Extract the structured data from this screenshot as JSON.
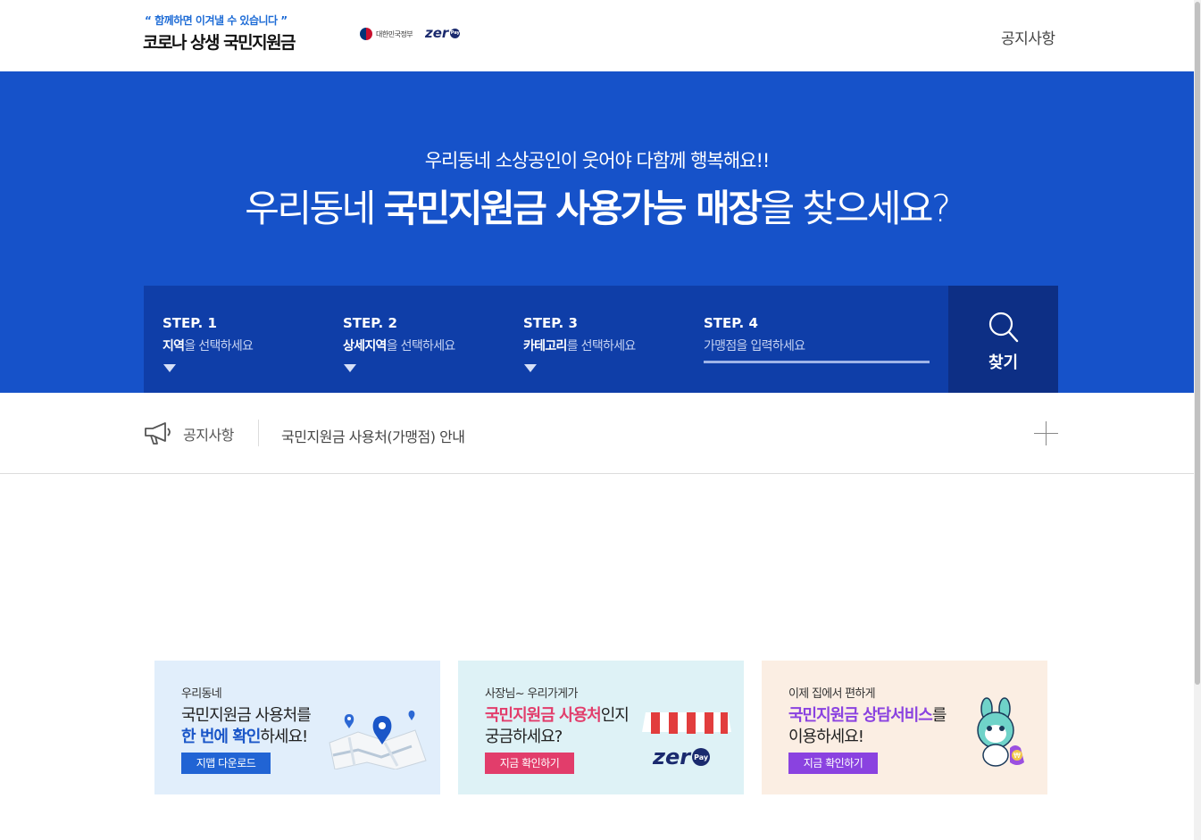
{
  "header": {
    "slogan": "“ 함께하면 이겨낼 수 있습니다 ”",
    "title": "코로나 상생 국민지원금",
    "gov_label": "대한민국정부",
    "zero_label": "zer",
    "zero_pay": "Pay",
    "nav_notice": "공지사항"
  },
  "hero": {
    "subtitle": "우리동네 소상공인이 웃어야 다함께 행복해요!!",
    "title_pre": "우리동네 ",
    "title_bold1": "국민지원금 사용가능 매장",
    "title_post": "을 찾으세요?"
  },
  "steps": [
    {
      "label": "STEP. 1",
      "hl": "지역",
      "rest": "을 선택하세요"
    },
    {
      "label": "STEP. 2",
      "hl": "상세지역",
      "rest": "을 선택하세요"
    },
    {
      "label": "STEP. 3",
      "hl": "카테고리",
      "rest": "를 선택하세요"
    },
    {
      "label": "STEP. 4",
      "placeholder": "가맹점을 입력하세요"
    }
  ],
  "search_label": "찾기",
  "notice": {
    "label": "공지사항",
    "text": "국민지원금 사용처(가맹점) 안내"
  },
  "banners": [
    {
      "small": "우리동네",
      "line1": "국민지원금 사용처를",
      "line2_hl": "한 번에 확인",
      "line2_rest": "하세요!",
      "button": "지맵 다운로드"
    },
    {
      "small": "사장님~ 우리가게가",
      "line1_hl": "국민지원금 사용처",
      "line1_rest": "인지",
      "line2": "궁금하세요?",
      "button": "지금 확인하기",
      "zero_label": "zer",
      "zero_pay": "Pay"
    },
    {
      "small": "이제 집에서 편하게",
      "line1_hl": "국민지원금 상담서비스",
      "line1_rest": "를",
      "line2": "이용하세요!",
      "button": "지금 확인하기"
    }
  ],
  "colors": {
    "hero_bg": "#1652c9",
    "steps_bg": "#0f3ea8",
    "search_bg": "#0d2f85",
    "accent_blue": "#2164d4",
    "accent_pink": "#e23d6b",
    "accent_purple": "#8a42e0"
  }
}
